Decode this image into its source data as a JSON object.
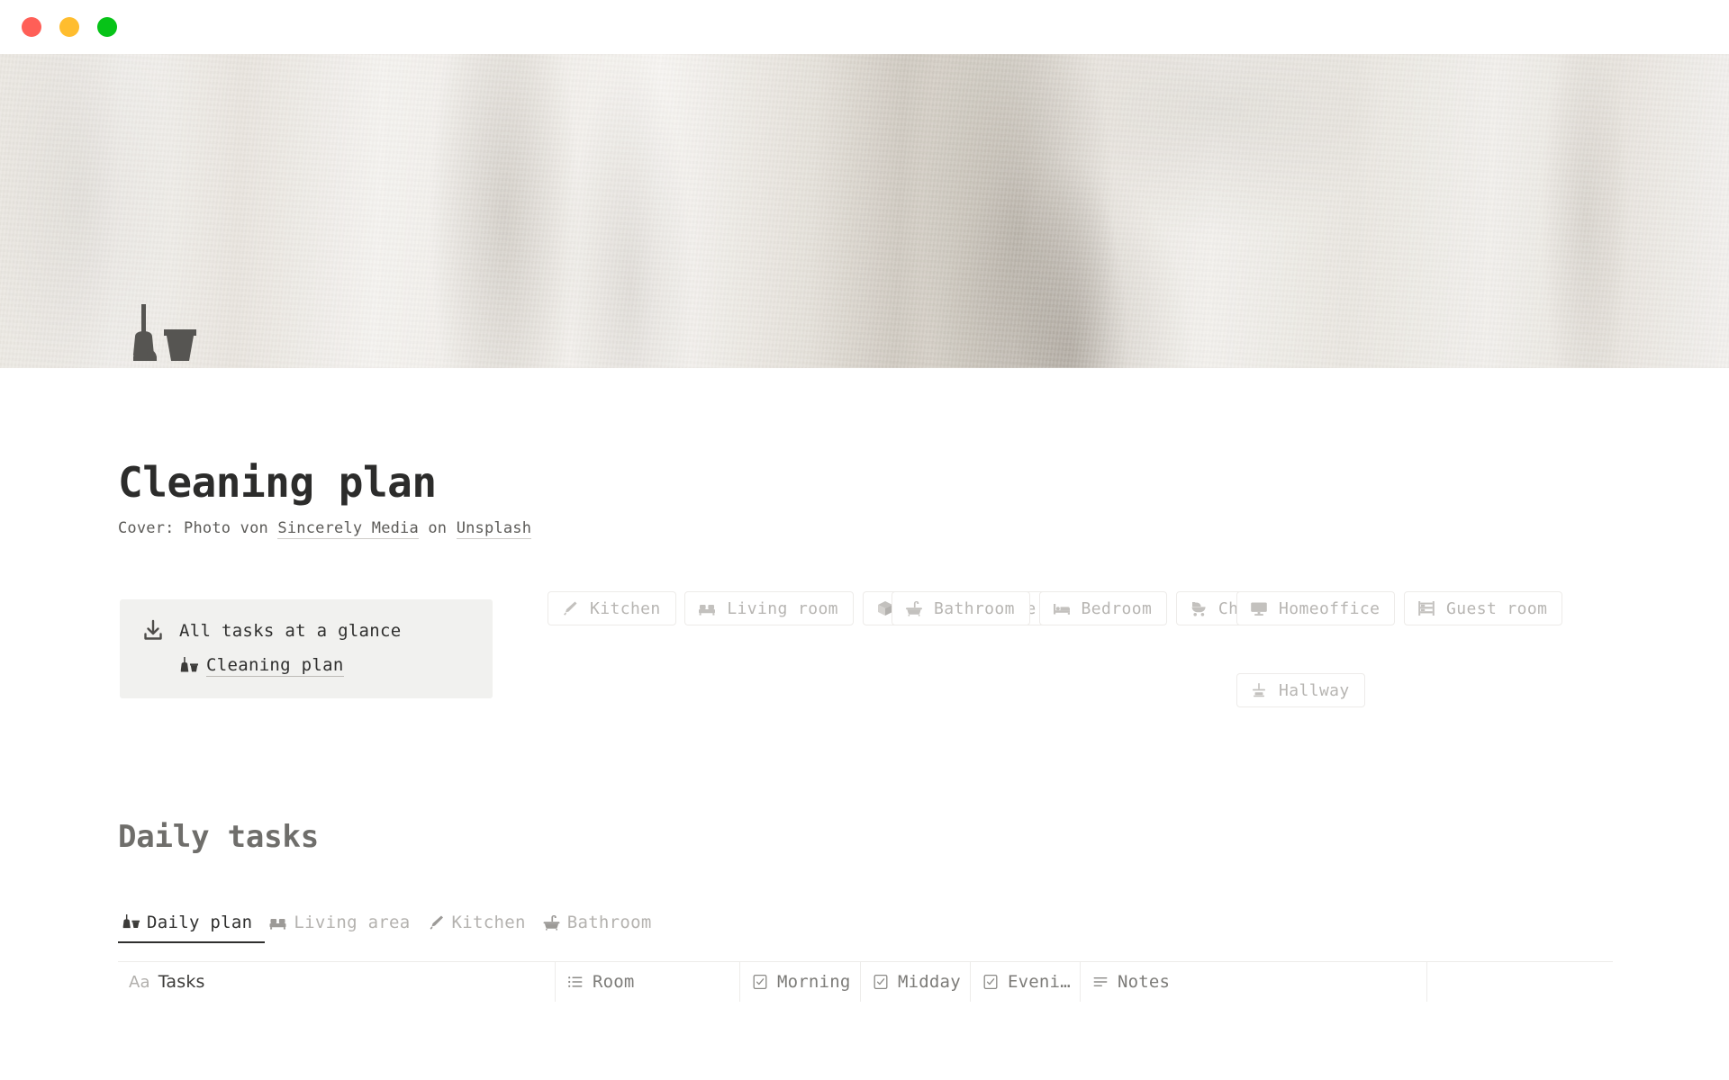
{
  "window": {
    "traffic_lights": [
      {
        "name": "close",
        "color": "#ff5f57"
      },
      {
        "name": "minimize",
        "color": "#ffbd2e"
      },
      {
        "name": "maximize",
        "color": "#07c318"
      }
    ]
  },
  "cover": {
    "alt": "crumpled white linen fabric",
    "page_icon": "broom-and-dustpan-icon"
  },
  "page": {
    "title": "Cleaning plan",
    "credit": {
      "prefix": "Cover: Photo von ",
      "author": "Sincerely Media",
      "middle": " on ",
      "source": "Unsplash"
    }
  },
  "callout": {
    "icon": "download-tray-icon",
    "title": "All tasks at a glance",
    "link_icon": "broom-and-dustpan-icon",
    "link_label": "Cleaning plan"
  },
  "rooms": {
    "columns": [
      [
        {
          "icon": "knife-icon",
          "label": "Kitchen"
        },
        {
          "icon": "sofa-icon",
          "label": "Living room"
        },
        {
          "icon": "box-icon",
          "label": "Storage space"
        }
      ],
      [
        {
          "icon": "bathtub-icon",
          "label": "Bathroom"
        },
        {
          "icon": "bed-icon",
          "label": "Bedroom"
        },
        {
          "icon": "stroller-icon",
          "label": "Child´s room"
        }
      ],
      [
        {
          "icon": "monitor-icon",
          "label": "Homeoffice"
        },
        {
          "icon": "bunk-bed-icon",
          "label": "Guest room"
        },
        {
          "icon": "coat-rack-icon",
          "label": "Hallway"
        }
      ]
    ]
  },
  "section": {
    "heading": "Daily tasks"
  },
  "tabs": [
    {
      "icon": "broom-and-dustpan-icon",
      "label": "Daily plan",
      "active": true
    },
    {
      "icon": "sofa-icon",
      "label": "Living area",
      "active": false
    },
    {
      "icon": "knife-icon",
      "label": "Kitchen",
      "active": false
    },
    {
      "icon": "bathtub-icon",
      "label": "Bathroom",
      "active": false
    }
  ],
  "table": {
    "columns": [
      {
        "icon": "title-aa-icon",
        "label": "Tasks"
      },
      {
        "icon": "list-icon",
        "label": "Room"
      },
      {
        "icon": "checkbox-icon",
        "label": "Morning"
      },
      {
        "icon": "checkbox-icon",
        "label": "Midday"
      },
      {
        "icon": "checkbox-icon",
        "label": "Eveni…"
      },
      {
        "icon": "text-lines-icon",
        "label": "Notes"
      }
    ]
  },
  "colors": {
    "text_dark": "#2f2f2e",
    "text_muted": "#b7b5b2",
    "callout_bg": "#f1f1ef",
    "border": "#edebe9"
  }
}
